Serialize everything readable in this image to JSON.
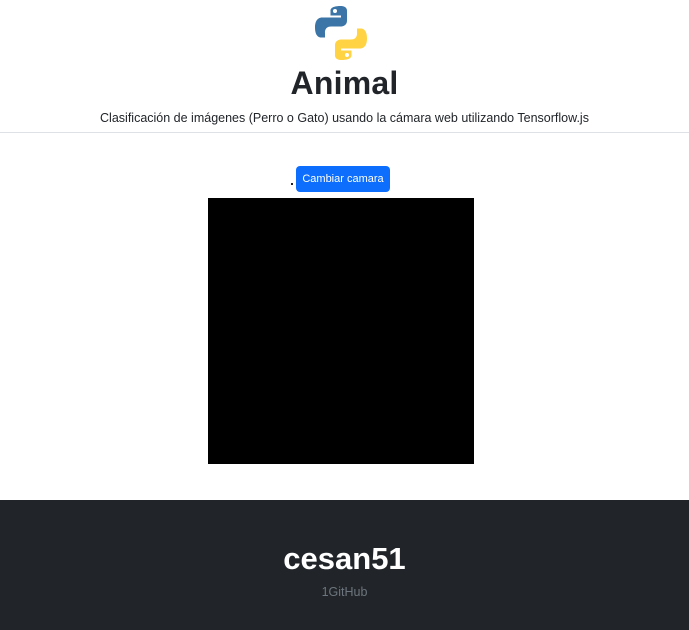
{
  "header": {
    "logo_icon": "python-logo-icon",
    "title": "Animal",
    "subtitle": "Clasificación de imágenes (Perro o Gato) usando la cámara web utilizando Tensorflow.js"
  },
  "main": {
    "switch_camera_label": "Cambiar camara"
  },
  "footer": {
    "author": "cesan51",
    "link_label": "1GitHub"
  },
  "colors": {
    "primary_button": "#0d6efd",
    "footer_bg": "#212529",
    "camera_bg": "#000000",
    "python_blue": "#3776ab",
    "python_yellow": "#ffd43b"
  }
}
